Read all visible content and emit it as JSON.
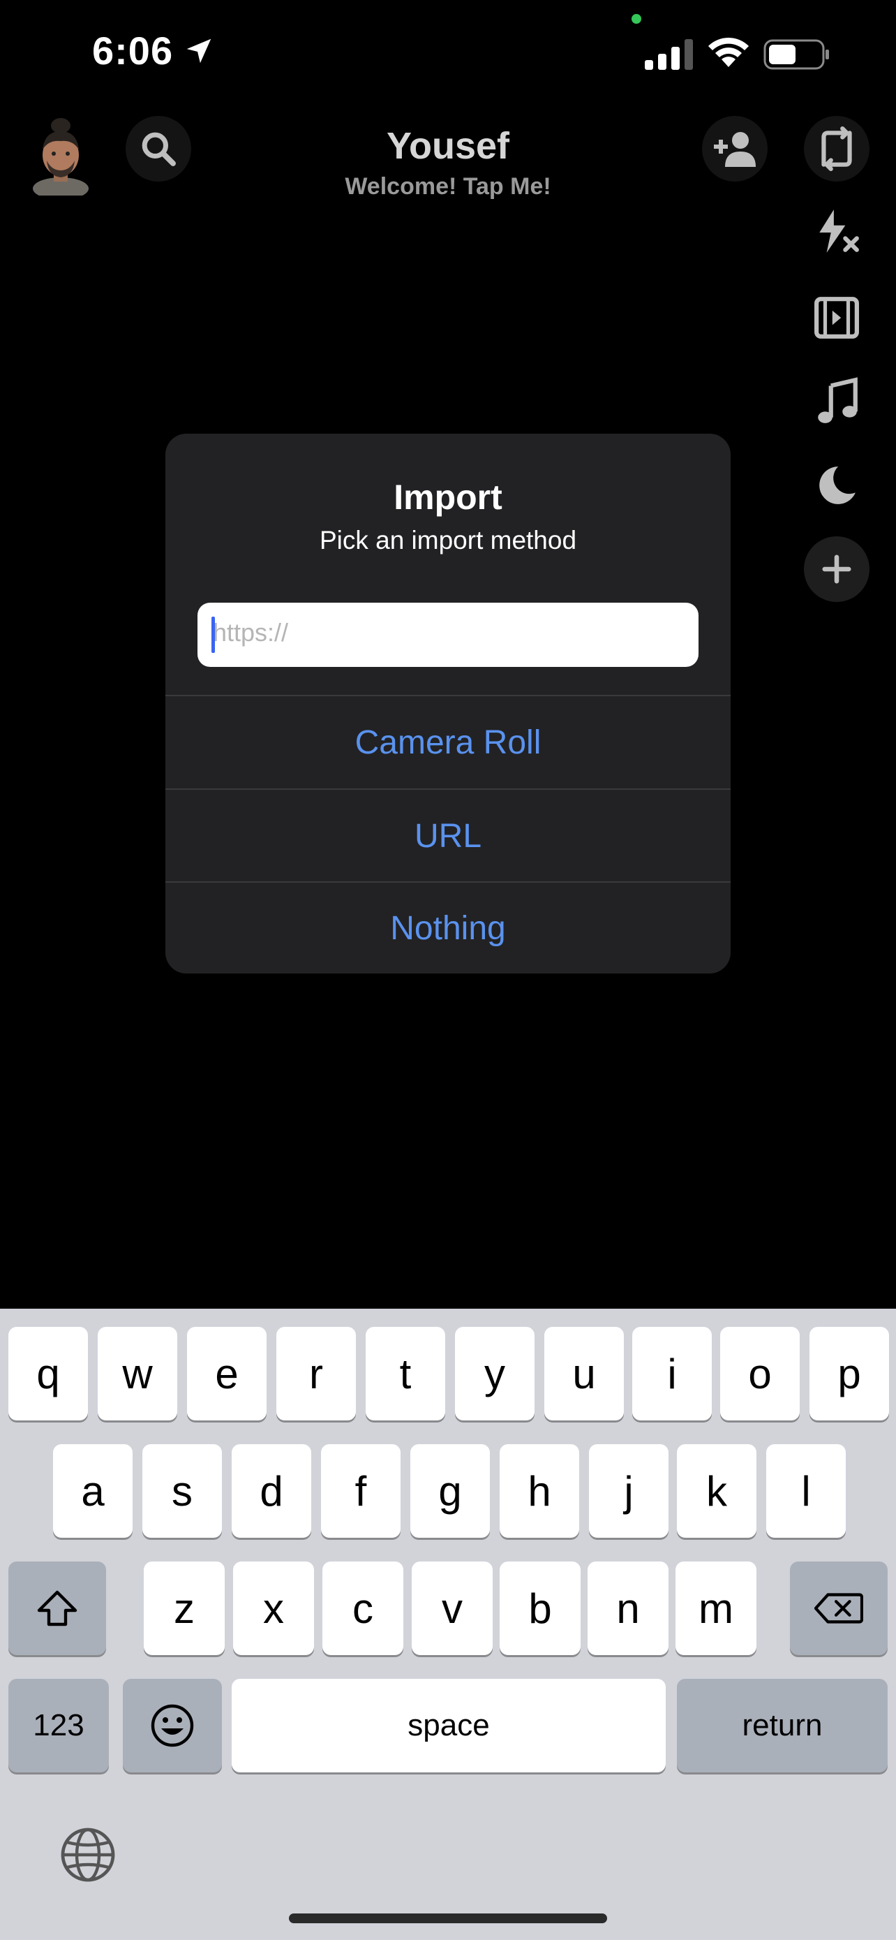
{
  "status_bar": {
    "time": "6:06"
  },
  "header": {
    "title": "Yousef",
    "subtitle": "Welcome! Tap Me!"
  },
  "dialog": {
    "title": "Import",
    "message": "Pick an import method",
    "input_placeholder": "https://",
    "input_value": "",
    "buttons": [
      "Camera Roll",
      "URL",
      "Nothing"
    ]
  },
  "keyboard": {
    "row1": [
      "q",
      "w",
      "e",
      "r",
      "t",
      "y",
      "u",
      "i",
      "o",
      "p"
    ],
    "row2": [
      "a",
      "s",
      "d",
      "f",
      "g",
      "h",
      "j",
      "k",
      "l"
    ],
    "row3": [
      "z",
      "x",
      "c",
      "v",
      "b",
      "n",
      "m"
    ],
    "numbers_label": "123",
    "space_label": "space",
    "return_label": "return"
  },
  "icons": [
    "location-arrow-icon",
    "signal-icon",
    "wifi-icon",
    "battery-icon",
    "bitmoji-avatar",
    "search-icon",
    "add-friend-icon",
    "flip-camera-icon",
    "flash-off-icon",
    "video-icon",
    "music-icon",
    "night-mode-icon",
    "plus-icon",
    "shift-icon",
    "backspace-icon",
    "emoji-icon",
    "globe-icon"
  ],
  "colors": {
    "accent": "#5a92ee",
    "dialog_bg": "#222224",
    "keyboard_bg": "#d1d3d9",
    "caret": "#3a64f3"
  }
}
